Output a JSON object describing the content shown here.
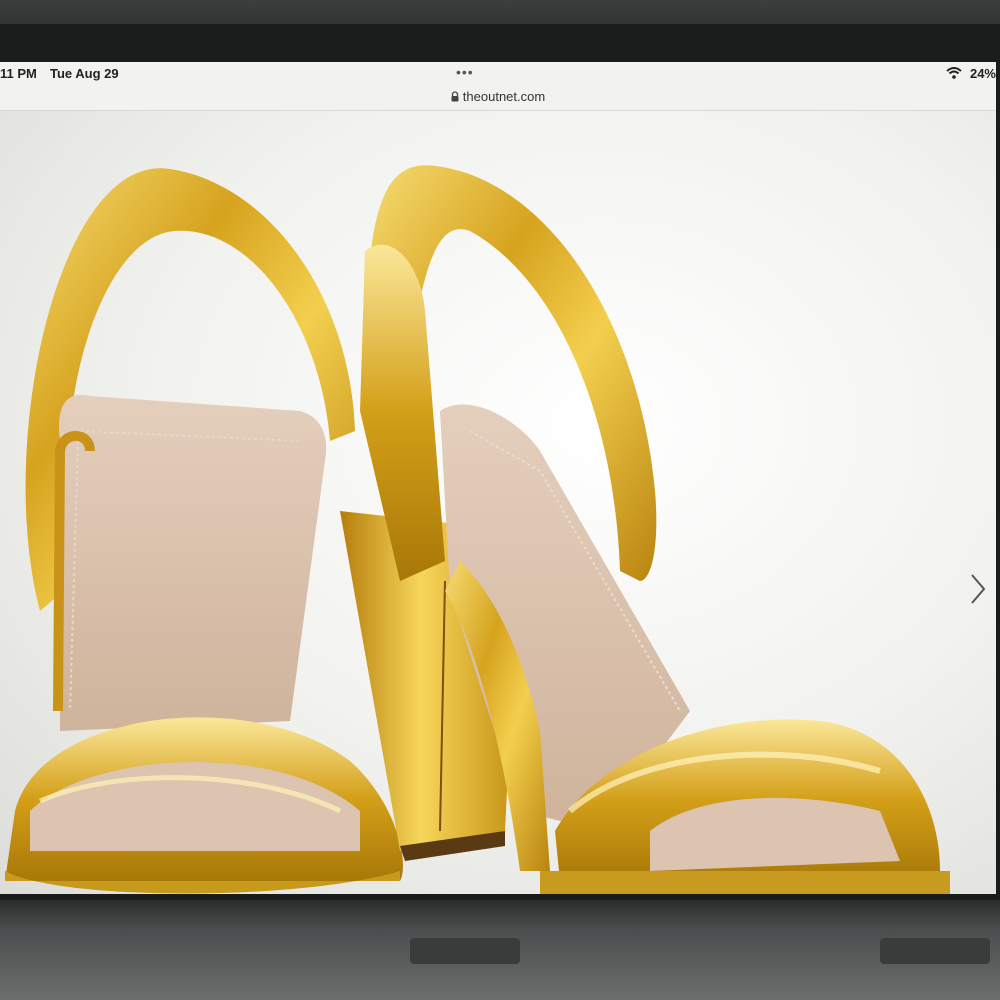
{
  "status_bar": {
    "time": "11 PM",
    "date": "Tue Aug 29",
    "more_dots": "•••",
    "battery": "24%",
    "wifi_icon": "wifi-icon"
  },
  "browser": {
    "url": "theoutnet.com",
    "lock_icon": "lock-icon"
  },
  "product_image": {
    "subject": "gold metallic sandals",
    "next_icon": "chevron-right-icon"
  },
  "colors": {
    "gold": "#d4a51c",
    "gold_light": "#f6dc72",
    "insole": "#dcc3ad",
    "background": "#eeeeea"
  }
}
